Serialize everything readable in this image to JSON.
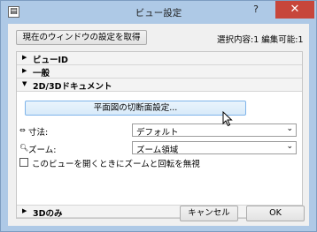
{
  "window": {
    "title": "ビュー設定",
    "help_label": "?",
    "close_label": "✕",
    "app_icon_glyph": "▤"
  },
  "top": {
    "get_settings_label": "現在のウィンドウの設定を取得",
    "selection_info": "選択内容:1 編集可能:1"
  },
  "sections": {
    "view_id": {
      "label": "ビューID",
      "expanded": false
    },
    "general": {
      "label": "一般",
      "expanded": false
    },
    "doc_2d3d": {
      "label": "2D/3Dドキュメント",
      "expanded": true
    },
    "only_3d": {
      "label": "3Dのみ",
      "expanded": false
    }
  },
  "doc_2d3d": {
    "cutplane_button_label": "平面図の切断面設定...",
    "dimension": {
      "label": "寸法:",
      "value": "デフォルト"
    },
    "zoom": {
      "label": "ズーム:",
      "value": "ズーム領域"
    },
    "checkbox": {
      "label": "このビューを開くときにズームと回転を無視",
      "checked": false
    }
  },
  "footer": {
    "cancel_label": "キャンセル",
    "ok_label": "OK"
  },
  "colors": {
    "frame": "#aec9e6",
    "close_button": "#c7463b",
    "client_bg": "#f0f0f0"
  }
}
